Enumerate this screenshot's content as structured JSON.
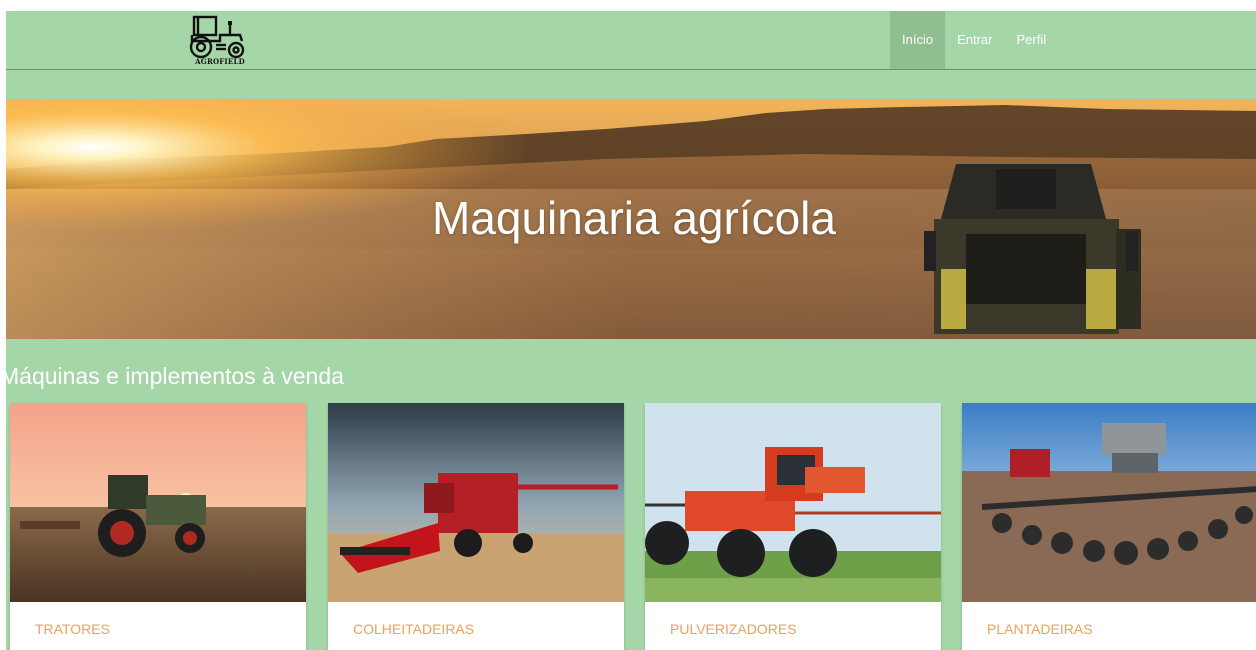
{
  "navbar": {
    "logo": {
      "text": "AGROFIELD",
      "icon": "tractor-icon"
    },
    "links": [
      {
        "label": "Início",
        "active": true
      },
      {
        "label": "Entrar",
        "active": false
      },
      {
        "label": "Perfil",
        "active": false
      }
    ]
  },
  "hero": {
    "title": "Maquinaria agrícola"
  },
  "section": {
    "title": "Máquinas e implementos à venda"
  },
  "cards": [
    {
      "label": "TRATORES"
    },
    {
      "label": "COLHEITADEIRAS"
    },
    {
      "label": "PULVERIZADORES"
    },
    {
      "label": "PLANTADEIRAS"
    }
  ],
  "colors": {
    "page_background": "#a5d6a7",
    "nav_active": "#8fbf91",
    "card_label": "#e8a25c"
  }
}
